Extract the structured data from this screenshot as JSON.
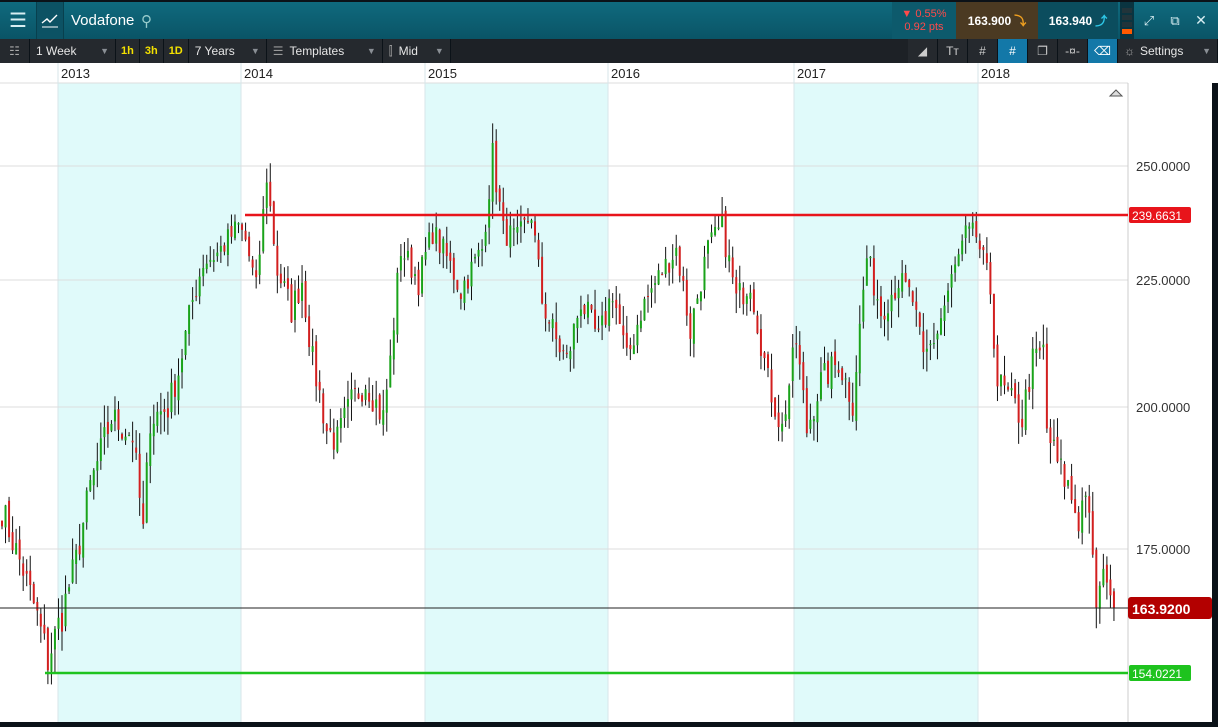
{
  "header": {
    "instrument": "Vodafone",
    "change_pct": "0.55%",
    "change_pts": "0.92 pts",
    "sell": "163.900",
    "buy": "163.940"
  },
  "toolbar": {
    "interval": "1 Week",
    "q1": "1h",
    "q2": "3h",
    "q3": "1D",
    "range": "7 Years",
    "templates": "Templates",
    "price_type": "Mid",
    "settings": "Settings"
  },
  "chart_data": {
    "type": "candlestick",
    "x_ticks": [
      "2013",
      "2014",
      "2015",
      "2016",
      "2017",
      "2018"
    ],
    "y_ticks": [
      "250.0000",
      "225.0000",
      "200.0000",
      "175.0000"
    ],
    "resistance": {
      "value": 239.6631,
      "label": "239.6631",
      "color": "#e8141b"
    },
    "support": {
      "value": 154.0221,
      "label": "154.0221",
      "color": "#1ec31e"
    },
    "last": {
      "value": 163.92,
      "label": "163.9200",
      "color": "#b30000"
    },
    "up_color": "#1aa31a",
    "down_color": "#d21f1f",
    "weekly_close_anchors": [
      [
        0,
        182
      ],
      [
        6,
        171
      ],
      [
        13,
        156
      ],
      [
        17,
        163
      ],
      [
        21,
        173
      ],
      [
        25,
        186
      ],
      [
        31,
        198
      ],
      [
        37,
        195
      ],
      [
        40,
        178
      ],
      [
        42,
        198
      ],
      [
        47,
        200
      ],
      [
        50,
        207
      ],
      [
        54,
        221
      ],
      [
        57,
        229
      ],
      [
        61,
        231
      ],
      [
        67,
        237
      ],
      [
        69,
        234
      ],
      [
        72,
        223
      ],
      [
        75,
        248
      ],
      [
        78,
        227
      ],
      [
        82,
        219
      ],
      [
        85,
        225
      ],
      [
        88,
        209
      ],
      [
        92,
        196
      ],
      [
        95,
        194
      ],
      [
        99,
        201
      ],
      [
        103,
        205
      ],
      [
        108,
        198
      ],
      [
        110,
        209
      ],
      [
        113,
        232
      ],
      [
        118,
        225
      ],
      [
        122,
        236
      ],
      [
        126,
        230
      ],
      [
        130,
        223
      ],
      [
        136,
        232
      ],
      [
        139,
        252
      ],
      [
        142,
        236
      ],
      [
        146,
        234
      ],
      [
        150,
        240
      ],
      [
        153,
        221
      ],
      [
        157,
        213
      ],
      [
        160,
        209
      ],
      [
        164,
        221
      ],
      [
        169,
        213
      ],
      [
        173,
        223
      ],
      [
        177,
        209
      ],
      [
        181,
        219
      ],
      [
        187,
        227
      ],
      [
        191,
        232
      ],
      [
        195,
        215
      ],
      [
        200,
        232
      ],
      [
        204,
        237
      ],
      [
        208,
        221
      ],
      [
        212,
        225
      ],
      [
        217,
        205
      ],
      [
        221,
        196
      ],
      [
        225,
        213
      ],
      [
        228,
        196
      ],
      [
        232,
        205
      ],
      [
        237,
        209
      ],
      [
        241,
        201
      ],
      [
        245,
        230
      ],
      [
        249,
        219
      ],
      [
        254,
        225
      ],
      [
        258,
        221
      ],
      [
        261,
        209
      ],
      [
        265,
        215
      ],
      [
        269,
        225
      ],
      [
        273,
        235
      ],
      [
        276,
        235
      ],
      [
        280,
        223
      ],
      [
        282,
        205
      ],
      [
        286,
        201
      ],
      [
        289,
        198
      ],
      [
        292,
        209
      ],
      [
        295,
        211
      ],
      [
        296,
        196
      ],
      [
        299,
        190
      ],
      [
        302,
        186
      ],
      [
        305,
        180
      ],
      [
        307,
        186
      ],
      [
        310,
        165
      ],
      [
        313,
        171
      ],
      [
        315,
        163.9
      ]
    ]
  }
}
